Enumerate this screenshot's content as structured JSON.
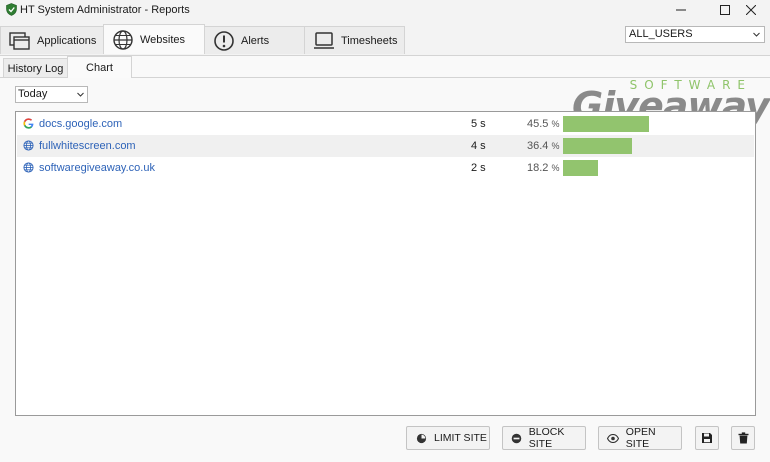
{
  "window": {
    "title": "HT System Administrator - Reports",
    "icons": {
      "app": "shield-check-icon",
      "minimize": "minimize-icon",
      "maximize": "maximize-icon",
      "close": "close-icon"
    }
  },
  "main_tabs": [
    {
      "label": "Applications",
      "icon": "windows-stack-icon"
    },
    {
      "label": "Websites",
      "icon": "globe-icon",
      "active": true
    },
    {
      "label": "Alerts",
      "icon": "exclamation-circle-icon"
    },
    {
      "label": "Timesheets",
      "icon": "laptop-icon"
    }
  ],
  "users_select": {
    "value": "ALL_USERS"
  },
  "sub_tabs": [
    {
      "label": "History Log"
    },
    {
      "label": "Chart",
      "active": true
    }
  ],
  "period_select": {
    "value": "Today"
  },
  "watermark": {
    "line1": "SOFTWARE",
    "line2": "Giveaway"
  },
  "colors": {
    "bar": "#92c46e",
    "link": "#2e63b8",
    "logo_green": "#8fc46a",
    "logo_gray": "#8a8a8a"
  },
  "sites": [
    {
      "name": "docs.google.com",
      "icon": "google-g-icon",
      "duration": "5 s",
      "percent_value": "45.5",
      "percent_unit": "%",
      "share": 0.455
    },
    {
      "name": "fullwhitescreen.com",
      "icon": "globe-icon",
      "duration": "4 s",
      "percent_value": "36.4",
      "percent_unit": "%",
      "share": 0.364
    },
    {
      "name": "softwaregiveaway.co.uk",
      "icon": "globe-icon",
      "duration": "2 s",
      "percent_value": "18.2",
      "percent_unit": "%",
      "share": 0.182
    }
  ],
  "actions": {
    "limit": {
      "label": "LIMIT SITE",
      "icon": "pie-clock-icon"
    },
    "block": {
      "label": "BLOCK SITE",
      "icon": "minus-circle-icon"
    },
    "open": {
      "label": "OPEN SITE",
      "icon": "eye-icon"
    },
    "save_icon": "save-icon",
    "delete_icon": "trash-icon"
  }
}
